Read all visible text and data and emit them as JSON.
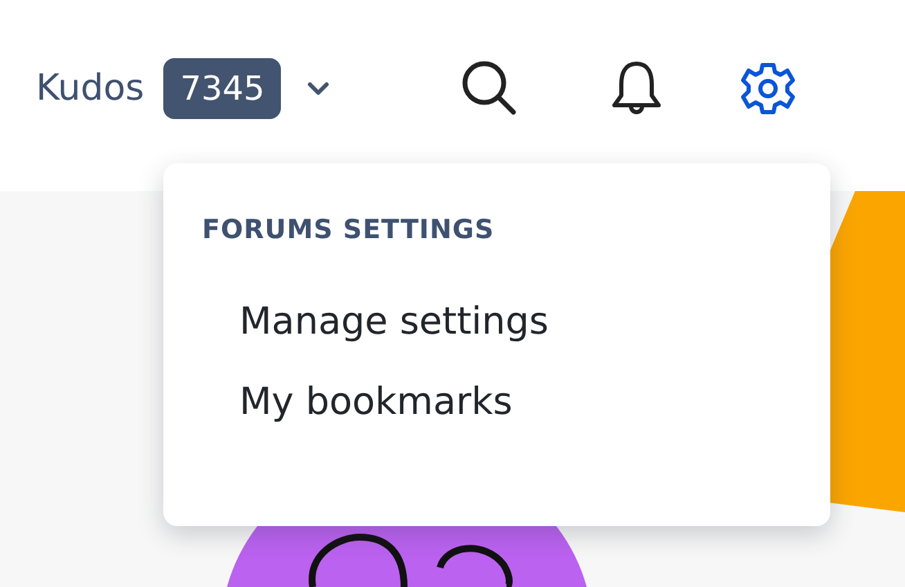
{
  "header": {
    "kudos_label": "Kudos",
    "kudos_count": "7345",
    "settings_open": true
  },
  "settings_menu": {
    "heading": "FORUMS SETTINGS",
    "items": [
      {
        "label": "Manage settings"
      },
      {
        "label": "My bookmarks"
      }
    ]
  }
}
